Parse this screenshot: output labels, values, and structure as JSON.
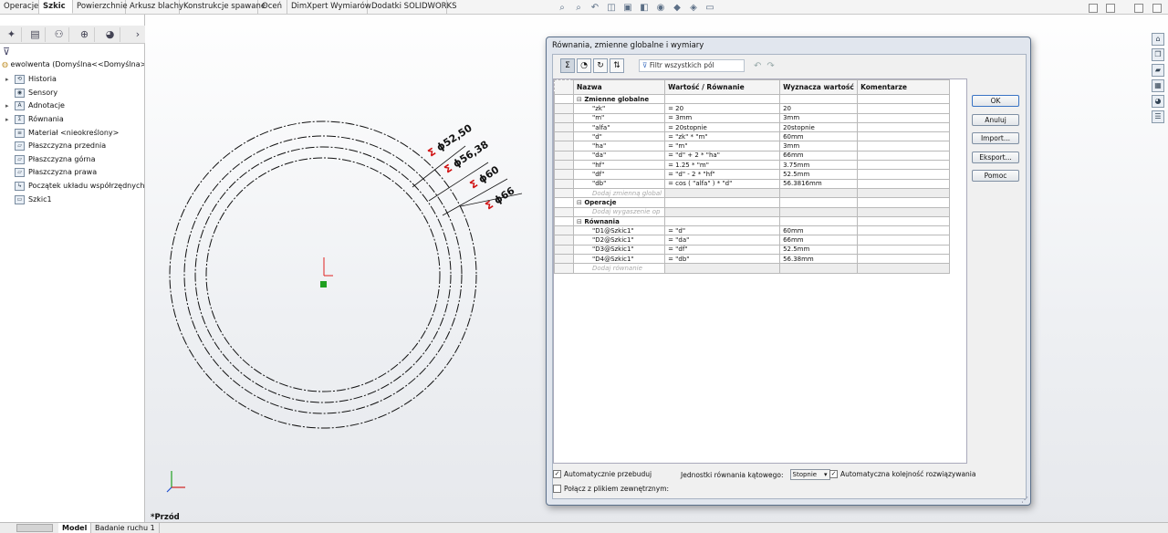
{
  "command_manager": {
    "tabs": [
      "Operacje",
      "Szkic",
      "Powierzchnie",
      "Arkusz blachy",
      "Konstrukcje spawane",
      "Oceń",
      "DimXpert Wymiarów",
      "Dodatki SOLIDWORKS"
    ]
  },
  "feature_tree": {
    "root": "ewolwenta  (Domyślna<<Domyślna>_St",
    "items": [
      {
        "label": "Historia",
        "icon": "history-icon",
        "expandable": true
      },
      {
        "label": "Sensory",
        "icon": "sensor-icon",
        "expandable": false
      },
      {
        "label": "Adnotacje",
        "icon": "annotation-icon",
        "expandable": true
      },
      {
        "label": "Równania",
        "icon": "equations-icon",
        "expandable": true
      },
      {
        "label": "Materiał <nieokreślony>",
        "icon": "material-icon",
        "expandable": false
      },
      {
        "label": "Płaszczyzna przednia",
        "icon": "plane-icon",
        "expandable": false
      },
      {
        "label": "Płaszczyzna górna",
        "icon": "plane-icon",
        "expandable": false
      },
      {
        "label": "Płaszczyzna prawa",
        "icon": "plane-icon",
        "expandable": false
      },
      {
        "label": "Początek układu współrzędnych",
        "icon": "origin-icon",
        "expandable": false
      },
      {
        "label": "Szkic1",
        "icon": "sketch-icon",
        "expandable": false
      }
    ]
  },
  "sketch": {
    "dimensions": [
      "52,50",
      "56,38",
      "60",
      "66"
    ],
    "prefix_symbol": "Σ",
    "diameter_symbol": "ϕ"
  },
  "view": {
    "label": "*Przód"
  },
  "bottom_tabs": [
    "Model",
    "Badanie ruchu 1"
  ],
  "dialog": {
    "title": "Równania, zmienne globalne i wymiary",
    "filter_placeholder": "Filtr wszystkich pól",
    "columns": [
      "Nazwa",
      "Wartość / Równanie",
      "Wyznacza wartość",
      "Komentarze"
    ],
    "sections": [
      {
        "title": "Zmienne globalne",
        "rows": [
          [
            "\"zk\"",
            "= 20",
            "20"
          ],
          [
            "\"m\"",
            "= 3mm",
            "3mm"
          ],
          [
            "\"alfa\"",
            "= 20stopnie",
            "20stopnie"
          ],
          [
            "\"d\"",
            "= \"zk\" * \"m\"",
            "60mm"
          ],
          [
            "\"ha\"",
            "= \"m\"",
            "3mm"
          ],
          [
            "\"da\"",
            "= \"d\" + 2 * \"ha\"",
            "66mm"
          ],
          [
            "\"hf\"",
            "= 1.25 * \"m\"",
            "3.75mm"
          ],
          [
            "\"df\"",
            "= \"d\" - 2 * \"hf\"",
            "52.5mm"
          ],
          [
            "\"db\"",
            "= cos ( \"alfa\" ) * \"d\"",
            "56.3816mm"
          ]
        ],
        "add_label": "Dodaj zmienną global"
      },
      {
        "title": "Operacje",
        "rows": [],
        "add_label": "Dodaj wygaszenie op"
      },
      {
        "title": "Równania",
        "rows": [
          [
            "\"D1@Szkic1\"",
            "= \"d\"",
            "60mm"
          ],
          [
            "\"D2@Szkic1\"",
            "= \"da\"",
            "66mm"
          ],
          [
            "\"D3@Szkic1\"",
            "= \"df\"",
            "52.5mm"
          ],
          [
            "\"D4@Szkic1\"",
            "= \"db\"",
            "56.38mm"
          ]
        ],
        "add_label": "Dodaj równanie"
      }
    ],
    "buttons": [
      "OK",
      "Anuluj",
      "Import...",
      "Eksport...",
      "Pomoc"
    ],
    "auto_rebuild_label": "Automatycznie przebuduj",
    "auto_rebuild_checked": true,
    "angle_units_label": "Jednostki równania kątowego:",
    "angle_units_value": "Stopnie",
    "auto_order_label": "Automatyczna kolejność rozwiązywania",
    "auto_order_checked": true,
    "link_external_label": "Połącz z plikiem zewnętrznym:",
    "link_external_checked": false
  },
  "colors": {
    "dimension_symbol": "#d01010",
    "origin_red": "#e02020",
    "origin_green": "#20a020",
    "dialog_frame": "#5a6f8a"
  }
}
